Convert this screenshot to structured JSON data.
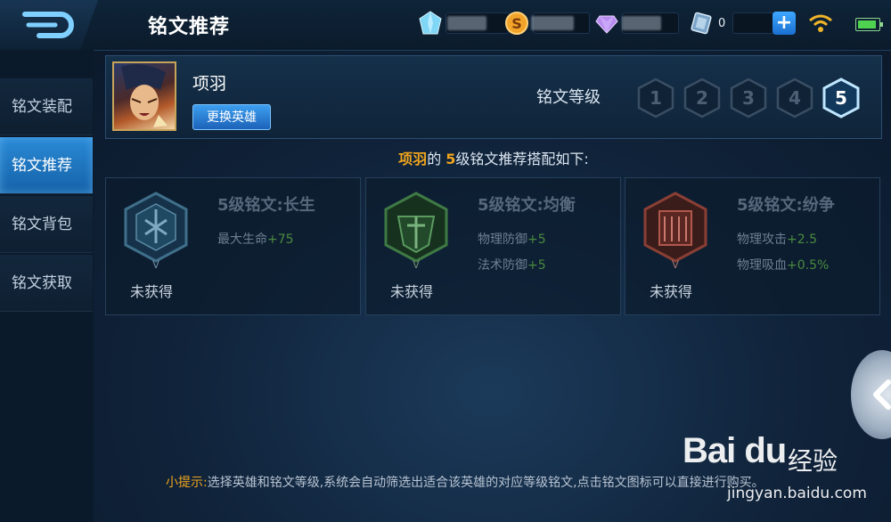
{
  "header": {
    "title": "铭文推荐",
    "back_icon": "back-arrow-icon",
    "resources": {
      "crystal_icon": "crystal-icon",
      "gold_icon": "gold-coin-icon",
      "diamond_icon": "diamond-icon",
      "voucher_icon": "voucher-icon",
      "voucher_value": "0",
      "add_label": "+"
    },
    "status": {
      "wifi_icon": "wifi-icon",
      "battery_icon": "battery-icon"
    }
  },
  "sidebar": {
    "items": [
      {
        "label": "铭文装配",
        "active": false
      },
      {
        "label": "铭文推荐",
        "active": true
      },
      {
        "label": "铭文背包",
        "active": false
      },
      {
        "label": "铭文获取",
        "active": false
      }
    ]
  },
  "hero": {
    "name": "项羽",
    "change_button": "更换英雄",
    "level_label": "铭文等级",
    "levels": [
      "1",
      "2",
      "3",
      "4",
      "5"
    ],
    "selected_level": "5"
  },
  "recommend": {
    "hero_name": "项羽",
    "mid": "的 ",
    "level": "5",
    "suffix": "级铭文推荐搭配如下:"
  },
  "cards": [
    {
      "title": "5级铭文:长生",
      "emblem_color": "#3f6f8a",
      "attrs": [
        {
          "name": "最大生命",
          "value": "+75"
        }
      ],
      "status": "未获得"
    },
    {
      "title": "5级铭文:均衡",
      "emblem_color": "#3f7a45",
      "attrs": [
        {
          "name": "物理防御",
          "value": "+5"
        },
        {
          "name": "法术防御",
          "value": "+5"
        }
      ],
      "status": "未获得"
    },
    {
      "title": "5级铭文:纷争",
      "emblem_color": "#8a3f35",
      "attrs": [
        {
          "name": "物理攻击",
          "value": "+2.5"
        },
        {
          "name": "物理吸血",
          "value": "+0.5%"
        }
      ],
      "status": "未获得"
    }
  ],
  "tip": {
    "label": "小提示:",
    "text": "选择英雄和铭文等级,系统会自动筛选出适合该英雄的对应等级铭文,点击铭文图标可以直接进行购买。"
  },
  "watermark": {
    "logo": "Bai du",
    "cn": "经验",
    "url": "jingyan.baidu.com"
  },
  "colors": {
    "accent": "#2a8ad6",
    "highlight": "#f0a51e",
    "plus_green": "#4a8a3f"
  }
}
